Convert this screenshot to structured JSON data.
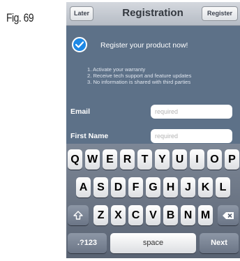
{
  "figure_label": "Fig. 69",
  "navbar": {
    "left_button": "Later",
    "title": "Registration",
    "right_button": "Register"
  },
  "content": {
    "headline": "Register your product now!",
    "benefits": [
      "1. Activate your warranty",
      "2. Receive tech support and feature updates",
      "3. No information is shared with third parties"
    ],
    "fields": [
      {
        "label": "Email",
        "placeholder": "required"
      },
      {
        "label": "First Name",
        "placeholder": "required"
      }
    ]
  },
  "keyboard": {
    "row1": [
      "Q",
      "W",
      "E",
      "R",
      "T",
      "Y",
      "U",
      "I",
      "O",
      "P"
    ],
    "row2": [
      "A",
      "S",
      "D",
      "F",
      "G",
      "H",
      "J",
      "K",
      "L"
    ],
    "row3": [
      "Z",
      "X",
      "C",
      "V",
      "B",
      "N",
      "M"
    ],
    "numbers_key": ".?123",
    "space_key": "space",
    "next_key": "Next",
    "icons": {
      "shift": "shift-icon",
      "delete": "delete-icon"
    }
  },
  "colors": {
    "background": "#5d7188",
    "check_blue": "#1e88e5",
    "keyboard": "#687282"
  }
}
